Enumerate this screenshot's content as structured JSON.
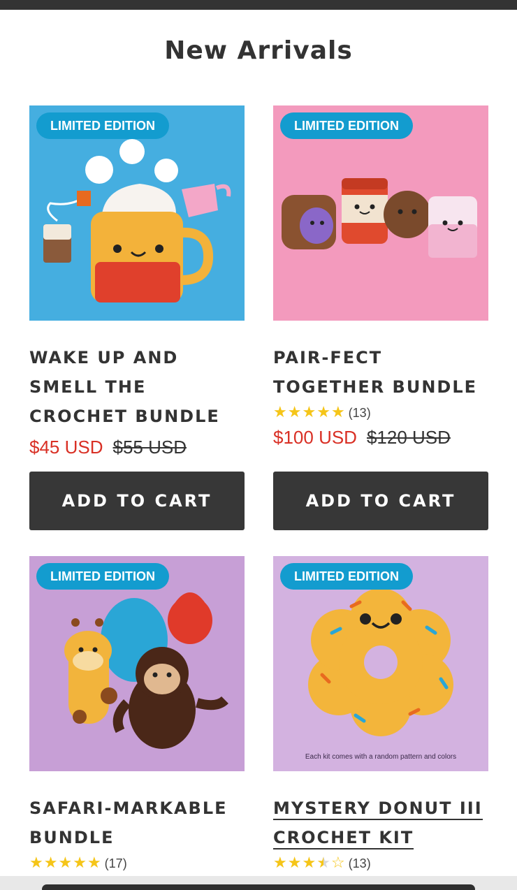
{
  "section": {
    "title": "New Arrivals"
  },
  "badge_label": "LIMITED EDITION",
  "colors": {
    "badge": "#139ccf",
    "sale": "#d93025",
    "button": "#373737",
    "star": "#f5c518"
  },
  "products": [
    {
      "title": "WAKE UP AND SMELL THE CROCHET BUNDLE",
      "sale_price": "$45 USD",
      "original_price": "$55 USD",
      "button": "ADD TO CART",
      "image_bg": "#45aee0"
    },
    {
      "title": "PAIR-FECT TOGETHER BUNDLE",
      "rating": 5,
      "reviews": "(13)",
      "sale_price": "$100 USD",
      "original_price": "$120 USD",
      "button": "ADD TO CART",
      "image_bg": "#f39abd"
    },
    {
      "title": "SAFARI-MARKABLE BUNDLE",
      "rating": 5,
      "reviews": "(17)",
      "image_bg": "#c79fd6"
    },
    {
      "title": "MYSTERY DONUT III CROCHET KIT",
      "title_line1": "MYSTERY DONUT III",
      "title_line2": "CROCHET KIT",
      "rating": 3.5,
      "reviews": "(13)",
      "image_caption": "Each kit comes with a random pattern and colors",
      "image_bg": "#d3b2e0"
    }
  ]
}
